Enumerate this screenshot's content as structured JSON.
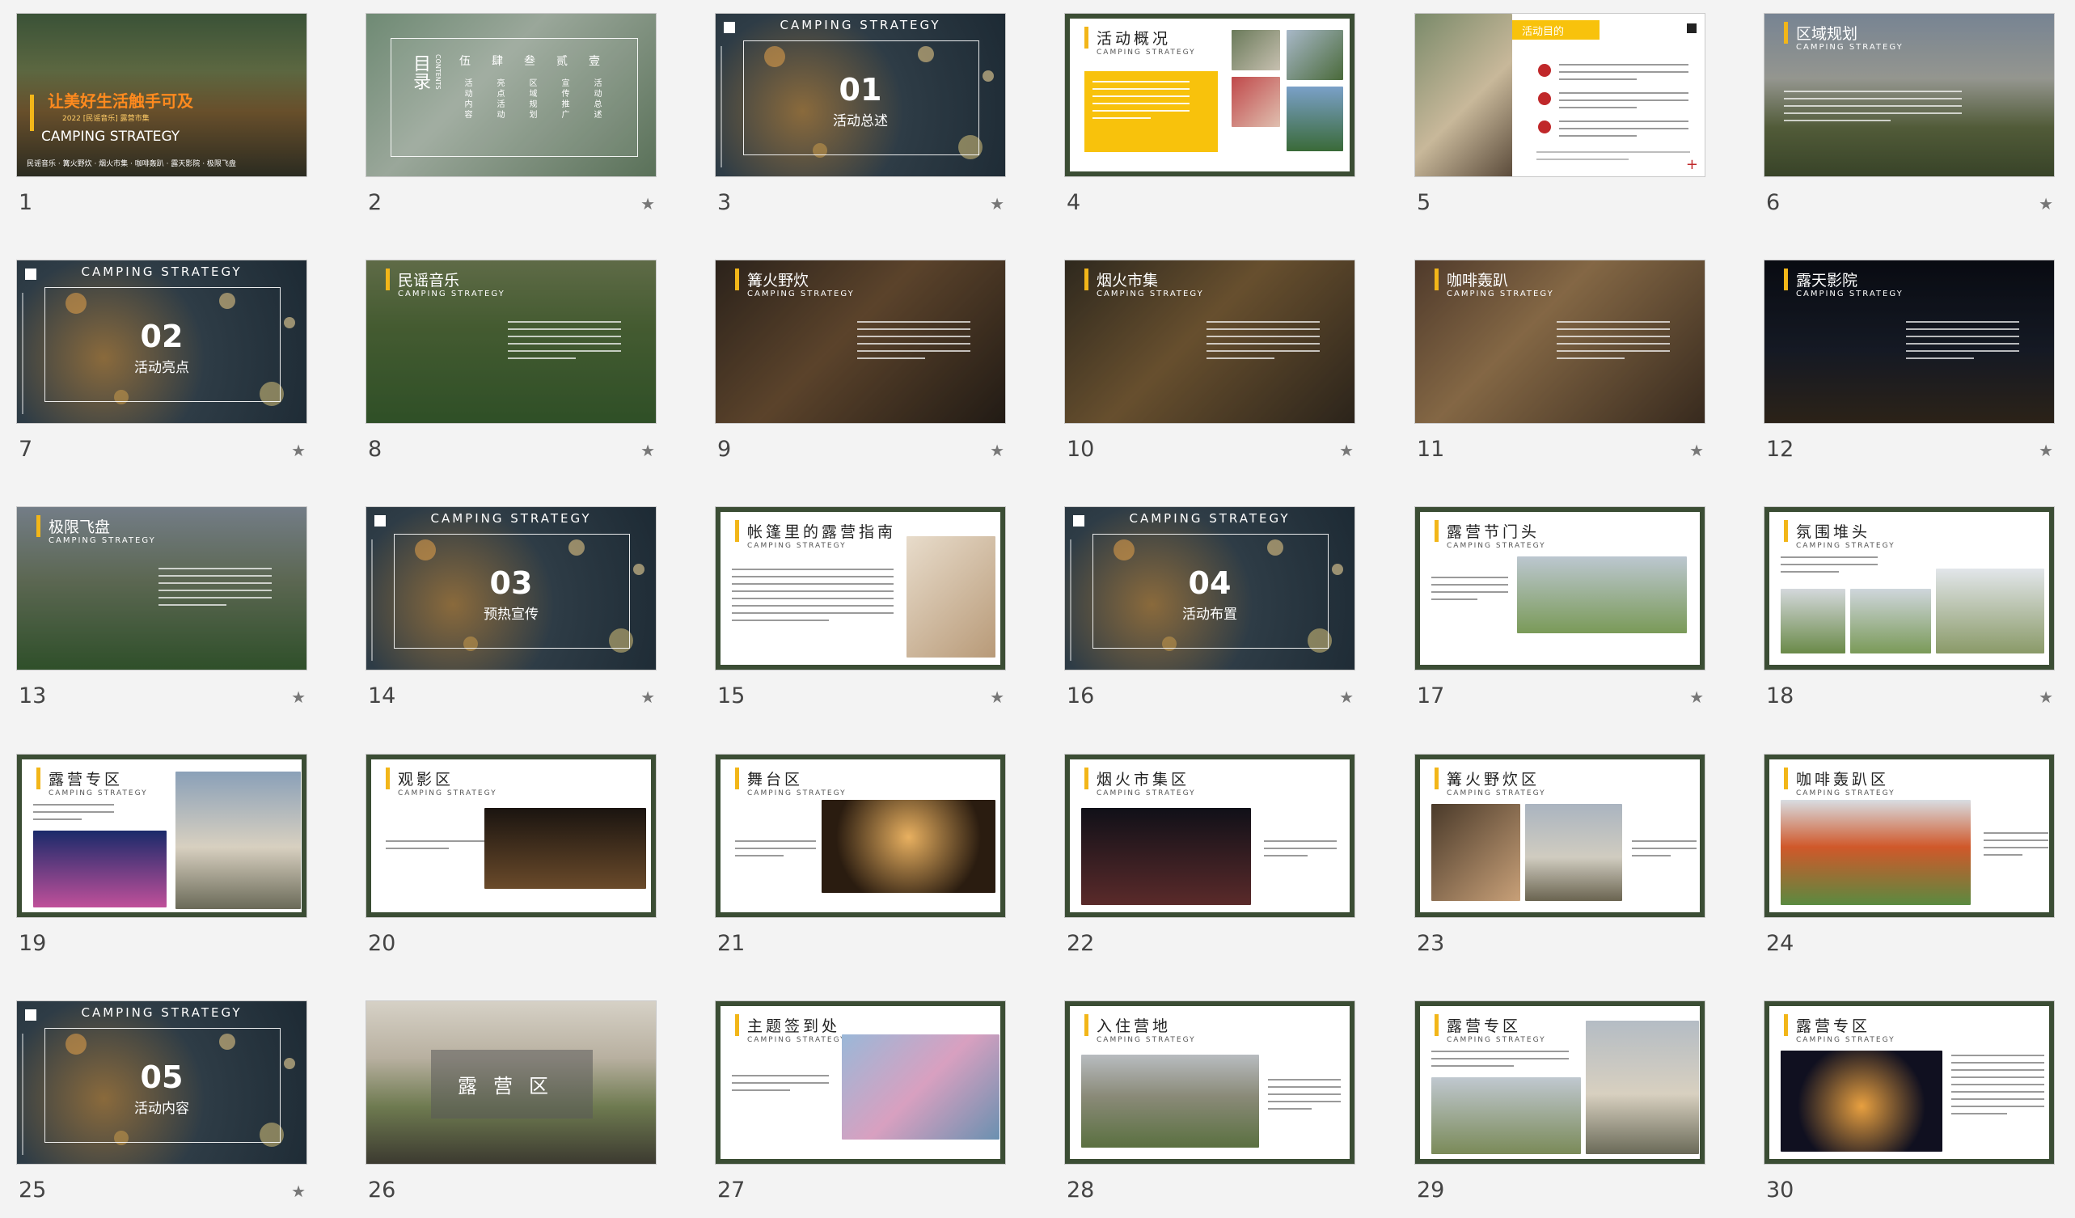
{
  "slides": [
    {
      "num": "1",
      "starred": false,
      "title": "让美好生活触手可及",
      "subtitle": "2022 [民谣音乐] 露营市集",
      "camping": "CAMPING STRATEGY",
      "tags": "民谣音乐 · 篝火野炊 · 烟火市集 · 咖啡轰趴 · 露天影院 · 极限飞盘"
    },
    {
      "num": "2",
      "starred": true,
      "title": "目录",
      "contents_en": "CONTENTS",
      "items": [
        "活动内容",
        "亮点活动",
        "区域规划",
        "宣传推广",
        "活动总述"
      ],
      "nums": [
        "伍",
        "肆",
        "叁",
        "贰",
        "壹"
      ]
    },
    {
      "num": "3",
      "starred": true,
      "head": "CAMPING STRATEGY",
      "sec_num": "01",
      "sec_label": "活动总述"
    },
    {
      "num": "4",
      "starred": false,
      "title": "活动概况",
      "sub": "CAMPING STRATEGY"
    },
    {
      "num": "5",
      "starred": false,
      "title": "活动目的"
    },
    {
      "num": "6",
      "starred": true,
      "title": "区域规划",
      "sub": "CAMPING STRATEGY"
    },
    {
      "num": "7",
      "starred": true,
      "head": "CAMPING STRATEGY",
      "sec_num": "02",
      "sec_label": "活动亮点"
    },
    {
      "num": "8",
      "starred": true,
      "title": "民谣音乐",
      "sub": "CAMPING STRATEGY"
    },
    {
      "num": "9",
      "starred": true,
      "title": "篝火野炊",
      "sub": "CAMPING STRATEGY"
    },
    {
      "num": "10",
      "starred": true,
      "title": "烟火市集",
      "sub": "CAMPING STRATEGY"
    },
    {
      "num": "11",
      "starred": true,
      "title": "咖啡轰趴",
      "sub": "CAMPING STRATEGY"
    },
    {
      "num": "12",
      "starred": true,
      "title": "露天影院",
      "sub": "CAMPING STRATEGY"
    },
    {
      "num": "13",
      "starred": true,
      "title": "极限飞盘",
      "sub": "CAMPING STRATEGY"
    },
    {
      "num": "14",
      "starred": true,
      "head": "CAMPING STRATEGY",
      "sec_num": "03",
      "sec_label": "预热宣传"
    },
    {
      "num": "15",
      "starred": true,
      "title": "帐篷里的露营指南",
      "sub": "CAMPING STRATEGY"
    },
    {
      "num": "16",
      "starred": true,
      "head": "CAMPING STRATEGY",
      "sec_num": "04",
      "sec_label": "活动布置"
    },
    {
      "num": "17",
      "starred": true,
      "title": "露营节门头",
      "sub": "CAMPING STRATEGY"
    },
    {
      "num": "18",
      "starred": true,
      "title": "氛围堆头",
      "sub": "CAMPING STRATEGY"
    },
    {
      "num": "19",
      "starred": false,
      "title": "露营专区",
      "sub": "CAMPING STRATEGY"
    },
    {
      "num": "20",
      "starred": false,
      "title": "观影区",
      "sub": "CAMPING STRATEGY"
    },
    {
      "num": "21",
      "starred": false,
      "title": "舞台区",
      "sub": "CAMPING STRATEGY"
    },
    {
      "num": "22",
      "starred": false,
      "title": "烟火市集区",
      "sub": "CAMPING STRATEGY"
    },
    {
      "num": "23",
      "starred": false,
      "title": "篝火野炊区",
      "sub": "CAMPING STRATEGY"
    },
    {
      "num": "24",
      "starred": false,
      "title": "咖啡轰趴区",
      "sub": "CAMPING STRATEGY"
    },
    {
      "num": "25",
      "starred": true,
      "head": "CAMPING STRATEGY",
      "sec_num": "05",
      "sec_label": "活动内容"
    },
    {
      "num": "26",
      "starred": false,
      "title": "露营区"
    },
    {
      "num": "27",
      "starred": false,
      "title": "主题签到处",
      "sub": "CAMPING STRATEGY"
    },
    {
      "num": "28",
      "starred": false,
      "title": "入住营地",
      "sub": "CAMPING STRATEGY"
    },
    {
      "num": "29",
      "starred": false,
      "title": "露营专区",
      "sub": "CAMPING STRATEGY"
    },
    {
      "num": "30",
      "starred": false,
      "title": "露营专区",
      "sub": "CAMPING STRATEGY"
    }
  ],
  "colors": {
    "accent": "#f2b619",
    "frame": "#3b4d34",
    "star": "#777777"
  },
  "icons": {
    "star": "star-icon"
  }
}
